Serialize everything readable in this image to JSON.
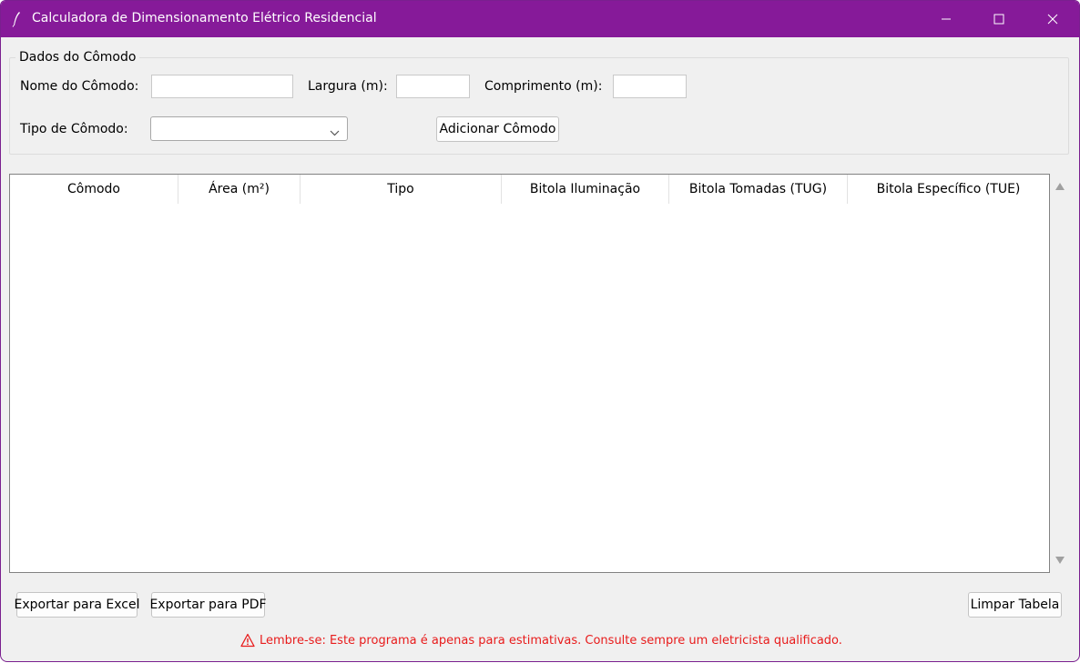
{
  "window": {
    "title": "Calculadora de Dimensionamento Elétrico Residencial",
    "titlebar_color": "#861a99",
    "icons": [
      "feather-icon",
      "minimize-icon",
      "maximize-icon",
      "close-icon"
    ]
  },
  "room_form": {
    "group_title": "Dados do Cômodo",
    "name_label": "Nome do Cômodo:",
    "name_value": "",
    "width_label": "Largura (m):",
    "width_value": "",
    "length_label": "Comprimento (m):",
    "length_value": "",
    "type_label": "Tipo de Cômodo:",
    "type_selected": "",
    "add_button": "Adicionar Cômodo"
  },
  "table": {
    "columns": [
      "Cômodo",
      "Área (m²)",
      "Tipo",
      "Bitola Iluminação",
      "Bitola Tomadas (TUG)",
      "Bitola Específico (TUE)"
    ],
    "rows": []
  },
  "actions": {
    "export_excel": "Exportar para Excel",
    "export_pdf": "Exportar para PDF",
    "clear_table": "Limpar Tabela"
  },
  "warning": {
    "icon": "warning-icon",
    "text": "Lembre-se: Este programa é apenas para estimativas. Consulte sempre um eletricista qualificado.",
    "color": "#e81b1b"
  }
}
